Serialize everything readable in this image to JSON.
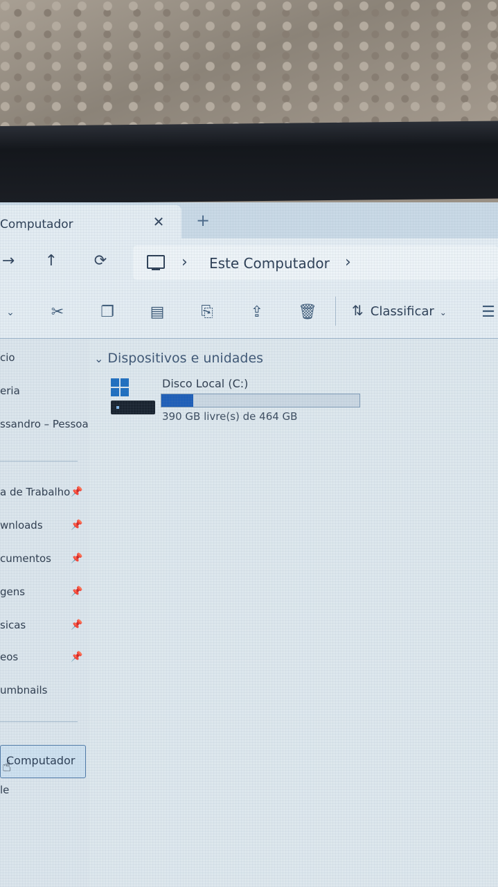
{
  "tab": {
    "title": "Computador",
    "close_label": "✕",
    "new_tab_label": "+"
  },
  "address": {
    "crumb": "Este Computador",
    "sep_before": "›",
    "sep_after": "›"
  },
  "toolbar": {
    "sort_label": "Classificar"
  },
  "sidebar": {
    "items_top": [
      "cio",
      "eria",
      "ssandro – Pessoa"
    ],
    "pinned": [
      {
        "label": "a de Trabalho"
      },
      {
        "label": "wnloads"
      },
      {
        "label": "cumentos"
      },
      {
        "label": "gens"
      },
      {
        "label": "sicas"
      },
      {
        "label": "eos"
      }
    ],
    "thumbnails": "umbnails",
    "selected": "Computador",
    "bottom": "le"
  },
  "main": {
    "group_title": "Dispositivos e unidades",
    "drive": {
      "name": "Disco Local (C:)",
      "free_text": "390 GB livre(s) de 464 GB",
      "used_fraction": 0.16
    }
  }
}
